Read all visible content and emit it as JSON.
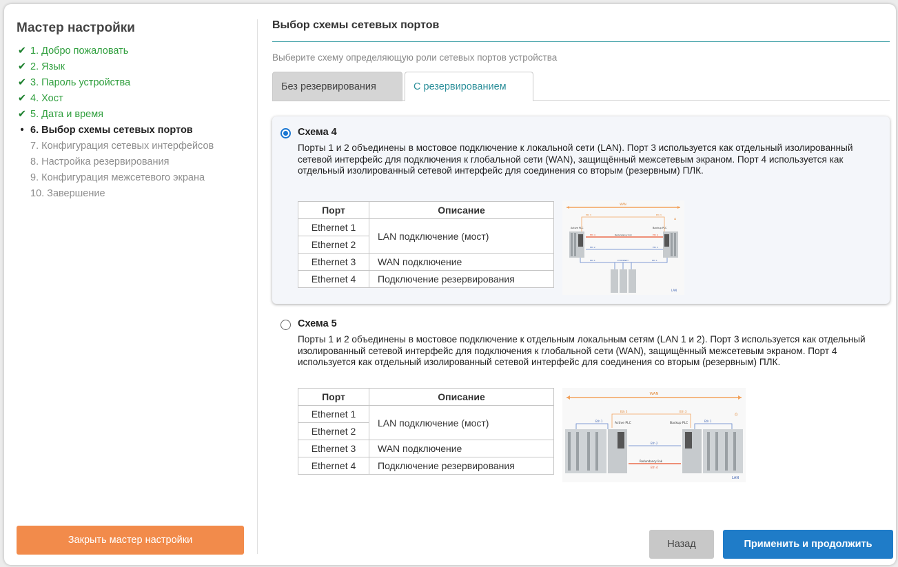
{
  "sidebar": {
    "title": "Мастер настройки",
    "steps": [
      {
        "label": "1. Добро пожаловать",
        "status": "done"
      },
      {
        "label": "2. Язык",
        "status": "done"
      },
      {
        "label": "3. Пароль устройства",
        "status": "done"
      },
      {
        "label": "4. Хост",
        "status": "done"
      },
      {
        "label": "5. Дата и время",
        "status": "done"
      },
      {
        "label": "6. Выбор схемы сетевых портов",
        "status": "current"
      },
      {
        "label": "7. Конфигурация сетевых интерфейсов",
        "status": "pending"
      },
      {
        "label": "8. Настройка резервирования",
        "status": "pending"
      },
      {
        "label": "9. Конфигурация межсетевого экрана",
        "status": "pending"
      },
      {
        "label": "10. Завершение",
        "status": "pending"
      }
    ],
    "close_button": "Закрыть мастер настройки"
  },
  "main": {
    "title": "Выбор схемы сетевых портов",
    "subtitle": "Выберите схему определяющую роли сетевых портов устройства",
    "tabs": [
      {
        "label": "Без резервирования",
        "active": false
      },
      {
        "label": "С резервированием",
        "active": true
      }
    ],
    "schemes": [
      {
        "name": "Схема 4",
        "selected": true,
        "description": "Порты 1 и 2 объединены в мостовое подключение к локальной сети (LAN). Порт 3 используется как отдельный изолированный сетевой интерфейс для подключения к глобальной сети (WAN), защищённый межсетевым экраном. Порт 4 используется как отдельный изолированный сетевой интерфейс для соединения со вторым (резервным) ПЛК.",
        "table": {
          "headers": [
            "Порт",
            "Описание"
          ],
          "ports": [
            "Ethernet 1",
            "Ethernet 2",
            "Ethernet 3",
            "Ethernet 4"
          ],
          "descriptions": [
            "LAN подключение (мост)",
            "WAN подключение",
            "Подключение резервирования"
          ]
        },
        "diagram": {
          "wan": "WAN",
          "lan": "LAN",
          "active_plc": "Active PLC",
          "backup_plc": "Backup PLC",
          "redundancy_link": "Redundancy link",
          "eth1": "Eth 1",
          "eth2": "Eth 2",
          "eth3": "Eth 3",
          "eth4": "Eth 4",
          "ethernet": "ETHERNET"
        }
      },
      {
        "name": "Схема 5",
        "selected": false,
        "description": "Порты 1 и 2 объединены в мостовое подключение к отдельным локальным сетям (LAN 1 и 2). Порт 3 используется как отдельный изолированный сетевой интерфейс для подключения к глобальной сети (WAN), защищённый межсетевым экраном. Порт 4 используется как отдельный изолированный сетевой интерфейс для соединения со вторым (резервным) ПЛК.",
        "table": {
          "headers": [
            "Порт",
            "Описание"
          ],
          "ports": [
            "Ethernet 1",
            "Ethernet 2",
            "Ethernet 3",
            "Ethernet 4"
          ],
          "descriptions": [
            "LAN подключение (мост)",
            "WAN подключение",
            "Подключение резервирования"
          ]
        },
        "diagram": {
          "wan": "WAN",
          "lan": "LAN",
          "active_plc": "Active PLC",
          "backup_plc": "Backup PLC",
          "redundancy_link": "Redundancy link",
          "eth1": "Eth 1",
          "eth2": "Eth 2",
          "eth3": "Eth 3",
          "eth4": "Eth 4"
        }
      }
    ],
    "back_button": "Назад",
    "apply_button": "Применить и продолжить"
  },
  "colors": {
    "done": "#2e9e3c",
    "accent": "#2a8e99",
    "close_button": "#f28b4b",
    "apply_button": "#1f7cc8",
    "radio": "#1976d2",
    "wan_line": "#f2a25c",
    "redundancy_line": "#e8502a",
    "eth_line": "#5b7fc7"
  }
}
